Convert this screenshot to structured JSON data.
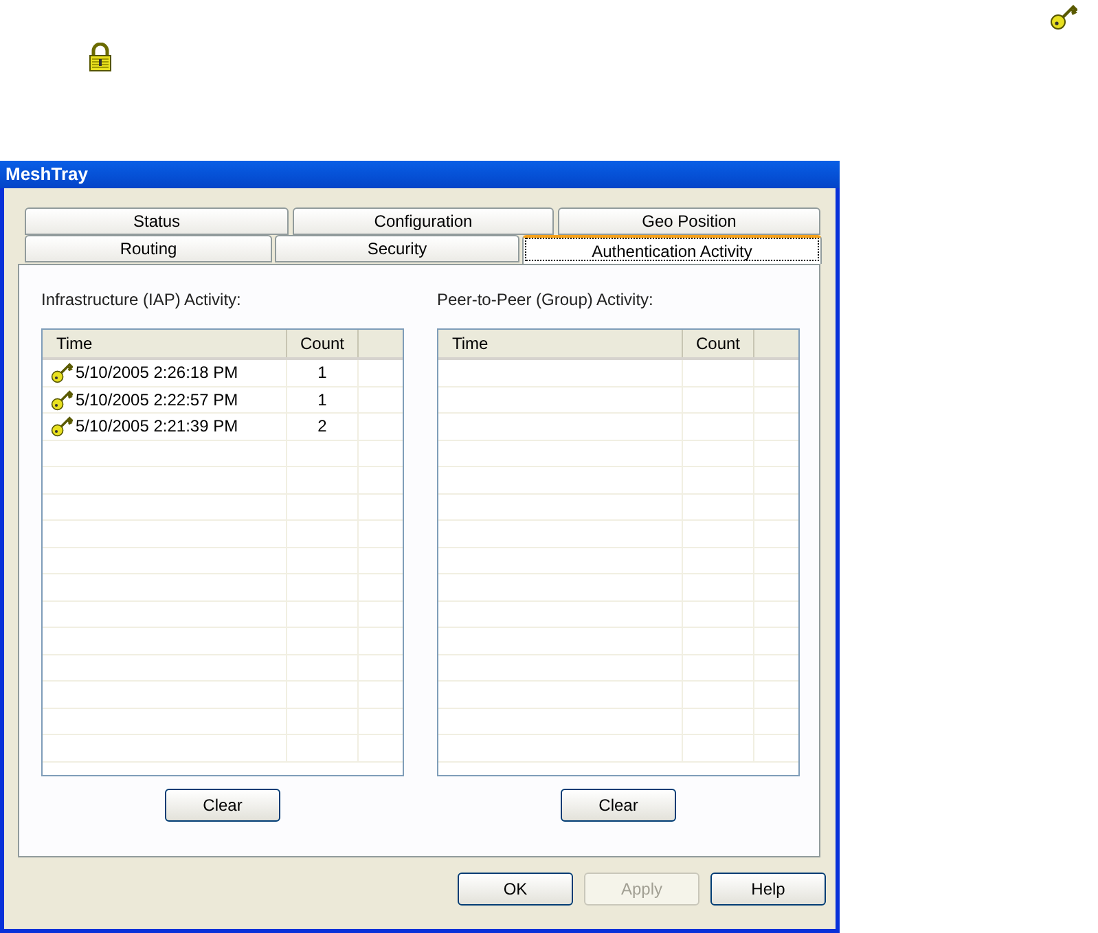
{
  "window": {
    "title": "MeshTray"
  },
  "tab_rows": [
    [
      {
        "label": "Status",
        "selected": false
      },
      {
        "label": "Configuration",
        "selected": false
      },
      {
        "label": "Geo Position",
        "selected": false
      }
    ],
    [
      {
        "label": "Routing",
        "selected": false
      },
      {
        "label": "Security",
        "selected": false
      },
      {
        "label": "Authentication Activity",
        "selected": true
      }
    ]
  ],
  "panels": [
    {
      "label": "Infrastructure (IAP) Activity:",
      "columns": [
        "Time",
        "Count"
      ],
      "rows": [
        {
          "time": "5/10/2005 2:26:18 PM",
          "count": "1"
        },
        {
          "time": "5/10/2005 2:22:57 PM",
          "count": "1"
        },
        {
          "time": "5/10/2005 2:21:39 PM",
          "count": "2"
        }
      ],
      "button": "Clear"
    },
    {
      "label": "Peer-to-Peer (Group) Activity:",
      "columns": [
        "Time",
        "Count"
      ],
      "button": "Clear"
    }
  ],
  "buttons": [
    {
      "label": "OK",
      "disabled": false
    },
    {
      "label": "Apply",
      "disabled": true
    },
    {
      "label": "Help",
      "disabled": false
    }
  ]
}
